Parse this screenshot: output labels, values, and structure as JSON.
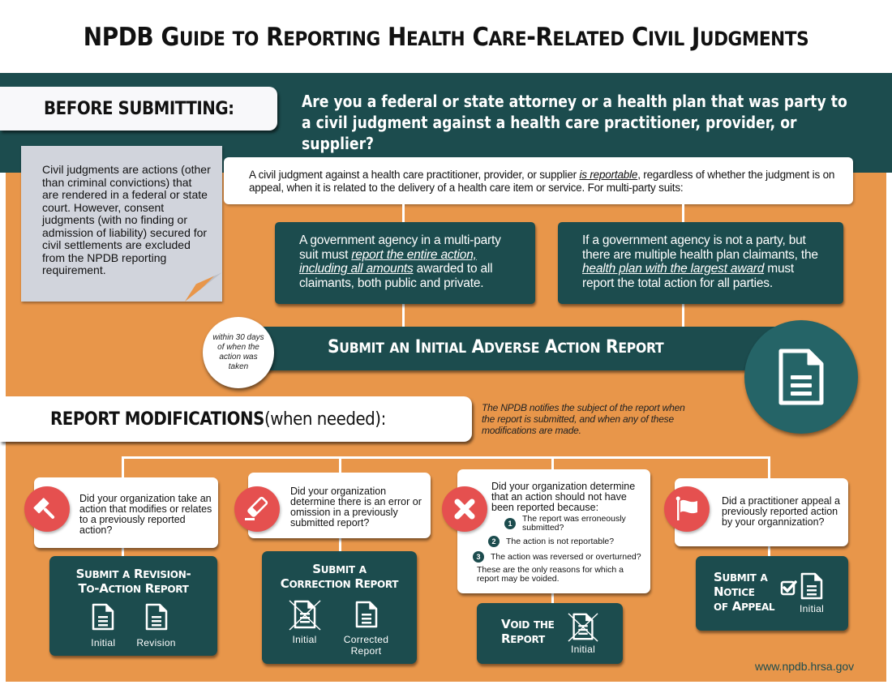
{
  "title": {
    "parts": [
      {
        "big": "N",
        "small": ""
      },
      {
        "big": "P",
        "small": ""
      },
      {
        "big": "D",
        "small": ""
      },
      {
        "big": "B",
        "small": ""
      }
    ],
    "text": "NPDB Guide to Reporting Health Care-Related Civil Judgments"
  },
  "colors": {
    "teal_dark": "#1C4C4E",
    "teal_circle": "#256467",
    "orange": "#E8964A",
    "red": "#E5504F",
    "note_gray": "#D1D4DC",
    "white": "#FFFFFF"
  },
  "before": {
    "label": "BEFORE SUBMITTING:",
    "question": "Are you a federal or state attorney or a health plan that was party to a civil judgment against a health care practitioner, provider, or supplier?"
  },
  "note": {
    "text": "Civil judgments are actions (other than criminal convictions) that are rendered in a federal or state court. However, consent judgments (with no finding or admission of liability) secured for civil settlements are excluded from the NPDB reporting requirement."
  },
  "reportable": {
    "before": "A civil judgment against a health care practitioner, provider, or supplier ",
    "emphasis": "is reportable",
    "after": ", regardless of whether the judgment is on appeal, when it is related to the delivery of a health care item or service. For multi-party suits:"
  },
  "multi_party": [
    {
      "before": "A government agency in a multi-party suit must ",
      "emphasis": "report the entire action, including all amounts",
      "after": " awarded to all claimants, both public and private."
    },
    {
      "before": "If a government agency is not a party, but there are multiple health plan claimants, the ",
      "emphasis": "health plan with the largest award",
      "after": " must report the total action for all parties."
    }
  ],
  "initial_report": {
    "deadline": "within 30 days of when the action was taken",
    "title": "Submit an Initial Adverse Action Report",
    "icon": "document-icon"
  },
  "modifications": {
    "label_bold": "REPORT MODIFICATIONS",
    "label_rest": " (when needed):",
    "note": "The NPDB notifies the subject of the report when the report is submitted, and when any of these modifications are made."
  },
  "scenarios": [
    {
      "icon": "gavel-icon",
      "question": "Did your organization take an action that modifies or relates to a previously reported action?",
      "action_title": "Submit a Revision-To-Action Report",
      "documents": [
        {
          "label": "Initial",
          "crossed": false
        },
        {
          "label": "Revision",
          "crossed": false
        }
      ]
    },
    {
      "icon": "pencil-eraser-icon",
      "question": "Did your organization determine there is an error or omission in a previously submitted report?",
      "action_title": "Submit a Correction Report",
      "documents": [
        {
          "label": "Initial",
          "crossed": true
        },
        {
          "label": "Corrected Report",
          "crossed": false
        }
      ]
    },
    {
      "icon": "x-icon",
      "question": "Did your organization determine that an action should not have been reported because:",
      "reasons": [
        {
          "number": "1",
          "text": "The report was erroneously submitted?"
        },
        {
          "number": "2",
          "text": "The action is not reportable?"
        },
        {
          "number": "3",
          "text": "The action was reversed or overturned?"
        }
      ],
      "footer": "These are the only reasons for which a report may be voided.",
      "action_title": "Void the Report",
      "documents": [
        {
          "label": "Initial",
          "crossed": true
        }
      ]
    },
    {
      "icon": "flag-icon",
      "question": "Did a practitioner appeal a previously reported  action by your organnization?",
      "action_title": "Submit a Notice of Appeal",
      "documents": [
        {
          "label": "Initial",
          "crossed": false,
          "checkbox": true
        }
      ]
    }
  ],
  "website": "www.npdb.hrsa.gov"
}
